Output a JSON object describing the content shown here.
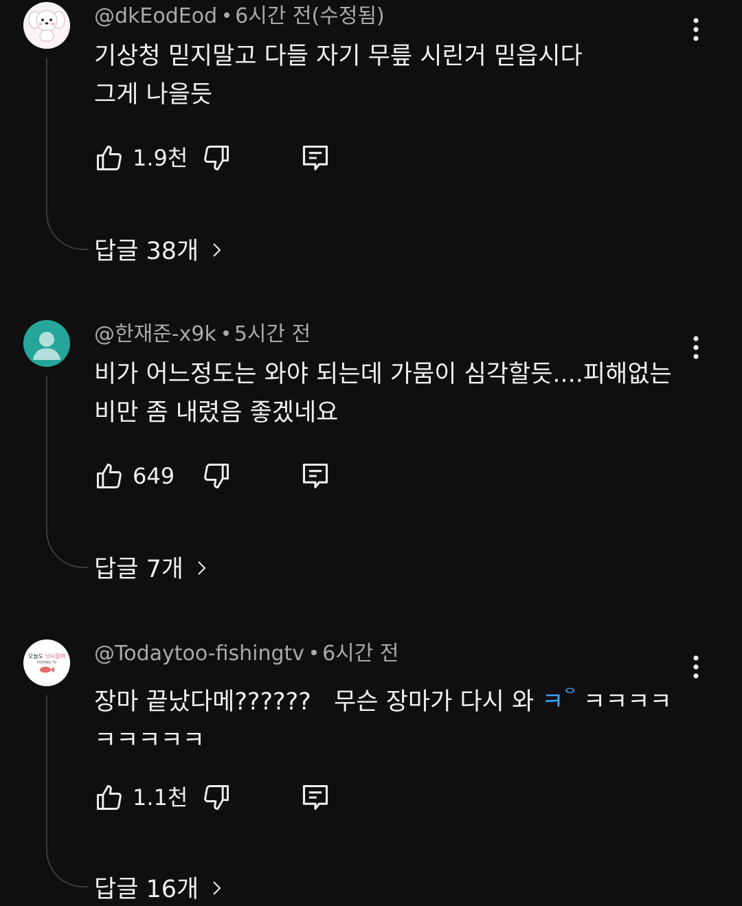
{
  "comments": [
    {
      "author": "@dkEodEod",
      "time": "6시간 전(수정됨)",
      "lines": [
        "기상청 믿지말고 다들 자기 무릎 시린거 믿읍시다",
        "그게 나을듯"
      ],
      "likes": "1.9천",
      "replies": "답글 38개",
      "avatar": "puppy-avatar"
    },
    {
      "author": "@한재준-x9k",
      "time": "5시간 전",
      "lines": [
        "비가 어느정도는 와야 되는데 가뭄이 심각할듯....피해없는",
        "비만 좀 내렸음 좋겠네요"
      ],
      "likes": "649",
      "replies": "답글 7개",
      "avatar": "default-person-avatar",
      "avatar_color": "#26a69a"
    },
    {
      "author": "@Todaytoo-fishingtv",
      "time": "6시간 전",
      "line1_prefix": "장마 끝났다메??????   무슨 장마가 다시 와 ",
      "line1_highlight": "ㅋ",
      "line1_sup": "ᄋ",
      "line1_suffix": "ㅋㅋㅋㅋ",
      "line2": "ㅋㅋㅋㅋㅋ",
      "likes": "1.1천",
      "replies": "답글 16개",
      "avatar": "fishing-channel-logo",
      "avatar_text_top": "오늘도",
      "avatar_text_pink": "낚시갈까",
      "avatar_text_sub": "FISHING TV"
    }
  ],
  "colors": {
    "background": "#0f0f0f",
    "primary_text": "#f1f1f1",
    "secondary_text": "#aaaaaa",
    "link_blue": "#3ea6ff"
  },
  "icons": [
    "thumbs-up-icon",
    "thumbs-down-icon",
    "reply-icon",
    "more-vert-icon",
    "chevron-right-icon"
  ]
}
